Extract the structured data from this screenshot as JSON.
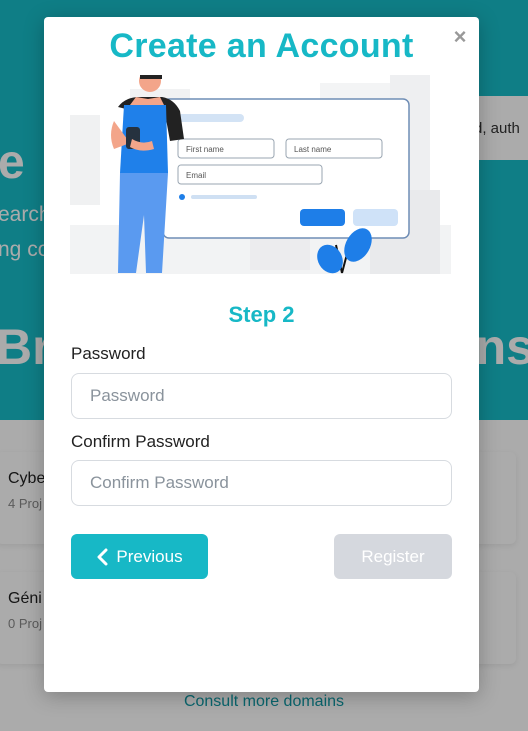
{
  "background": {
    "hero_letter": "e",
    "hero_line1": "earch",
    "hero_line2": "ng co",
    "hero_title_left": "Br",
    "hero_title_right": "ns",
    "search_snippet": "d, auth",
    "cards": [
      {
        "title": "Cybe",
        "subtitle": "4 Proj"
      },
      {
        "title": "Géni",
        "subtitle": "0 Proj"
      }
    ],
    "consult_link": "Consult more domains"
  },
  "modal": {
    "title": "Create an Account",
    "close_glyph": "×",
    "illustration": {
      "first_name": "First name",
      "last_name": "Last name",
      "email": "Email"
    },
    "step_title": "Step 2",
    "password": {
      "label": "Password",
      "placeholder": "Password",
      "value": ""
    },
    "confirm_password": {
      "label": "Confirm Password",
      "placeholder": "Confirm Password",
      "value": ""
    },
    "previous_label": "Previous",
    "register_label": "Register"
  },
  "colors": {
    "accent": "#17b8c6",
    "disabled": "#d5d8de",
    "illustration_blue": "#1e7ee8"
  }
}
